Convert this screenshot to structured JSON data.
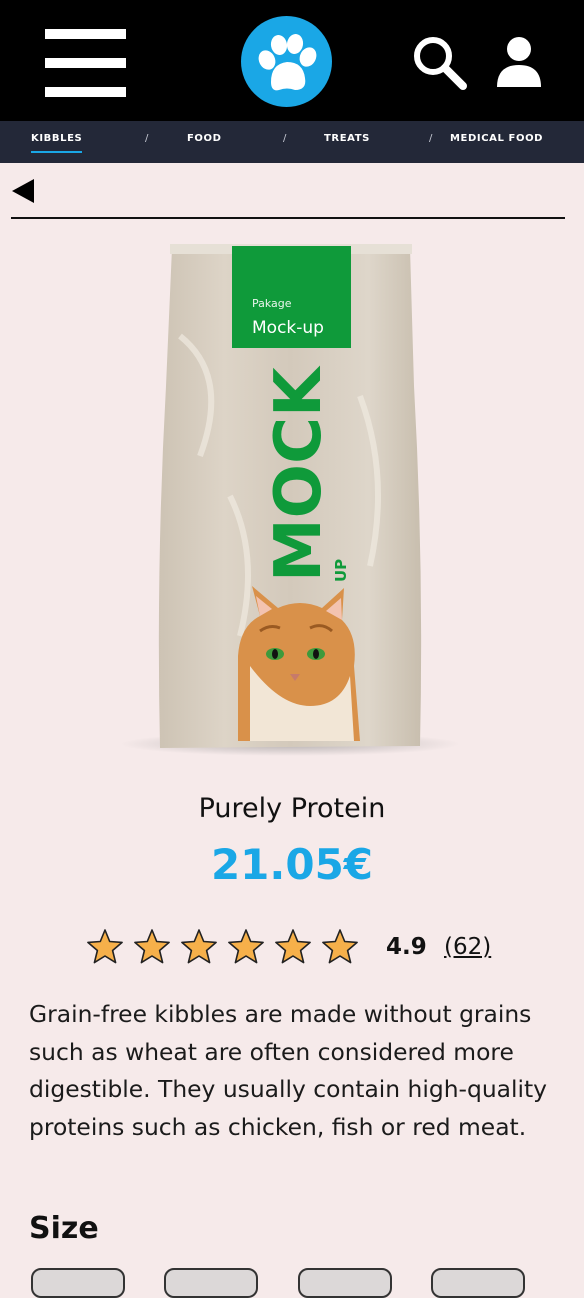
{
  "header": {
    "menu_icon": "hamburger-menu-icon",
    "logo_icon": "paw-logo-icon",
    "search_icon": "search-icon",
    "account_icon": "user-icon",
    "colors": {
      "background": "#000000",
      "logo": "#1aa7e6"
    }
  },
  "categories": {
    "items": [
      {
        "label": "KIBBLES",
        "active": true
      },
      {
        "label": "FOOD",
        "active": false
      },
      {
        "label": "TREATS",
        "active": false
      },
      {
        "label": "MEDICAL FOOD",
        "active": false
      }
    ],
    "separator": "/",
    "colors": {
      "background": "#232838",
      "active_underline": "#1aa7e6"
    }
  },
  "nav": {
    "back_icon": "back-arrow-icon"
  },
  "product": {
    "image": {
      "package_small_text": "Pakage",
      "package_label": "Mock-up",
      "package_big_text": "MOCK",
      "package_side_text": "UP"
    },
    "name": "Purely Protein",
    "price": "21.05€",
    "rating": {
      "stars": 6,
      "value": "4.9",
      "count": "(62)"
    },
    "description": "Grain-free kibbles are made without grains such as wheat are often considered more digestible. They usually contain high-quality proteins such as chicken, fish or red meat.",
    "colors": {
      "price": "#1aa7e6",
      "star": "#f6b04a",
      "package_green": "#0f9a3a"
    }
  },
  "size": {
    "heading": "Size",
    "options": [
      {},
      {},
      {},
      {}
    ]
  }
}
